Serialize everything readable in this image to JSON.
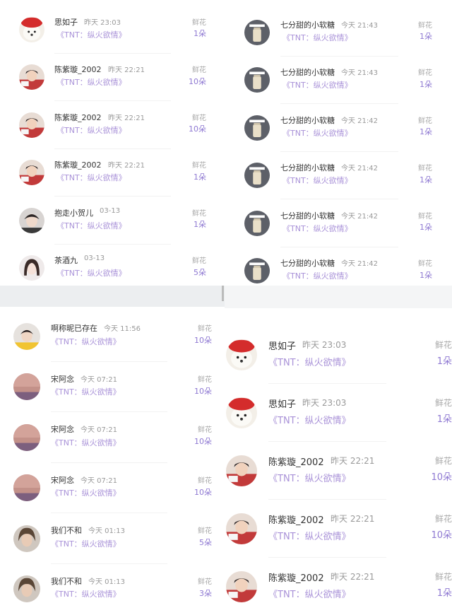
{
  "panels": [
    {
      "id": "top-left",
      "rows": [
        {
          "name": "思如子",
          "time": "昨天 23:03",
          "title": "《TNT：纵火欲情》",
          "gift": "鲜花",
          "count": "1朵",
          "avatar": "dog"
        },
        {
          "name": "陈紫璇_2002",
          "time": "昨天 22:21",
          "title": "《TNT：纵火欲情》",
          "gift": "鲜花",
          "count": "10朵",
          "avatar": "boy-red"
        },
        {
          "name": "陈紫璇_2002",
          "time": "昨天 22:21",
          "title": "《TNT：纵火欲情》",
          "gift": "鲜花",
          "count": "10朵",
          "avatar": "boy-red"
        },
        {
          "name": "陈紫璇_2002",
          "time": "昨天 22:21",
          "title": "《TNT：纵火欲情》",
          "gift": "鲜花",
          "count": "1朵",
          "avatar": "boy-red"
        },
        {
          "name": "抱走小贺儿",
          "time": "03-13",
          "title": "《TNT：纵火欲情》",
          "gift": "鲜花",
          "count": "1朵",
          "avatar": "boy-dark"
        },
        {
          "name": "茶酒九",
          "time": "03-13",
          "title": "《TNT：纵火欲情》",
          "gift": "鲜花",
          "count": "5朵",
          "avatar": "girl"
        }
      ]
    },
    {
      "id": "top-right",
      "rows": [
        {
          "name": "七分甜的小软糖",
          "time": "今天 21:43",
          "title": "《TNT：纵火欲情》",
          "gift": "鲜花",
          "count": "1朵",
          "avatar": "jar"
        },
        {
          "name": "七分甜的小软糖",
          "time": "今天 21:43",
          "title": "《TNT：纵火欲情》",
          "gift": "鲜花",
          "count": "1朵",
          "avatar": "jar"
        },
        {
          "name": "七分甜的小软糖",
          "time": "今天 21:42",
          "title": "《TNT：纵火欲情》",
          "gift": "鲜花",
          "count": "1朵",
          "avatar": "jar"
        },
        {
          "name": "七分甜的小软糖",
          "time": "今天 21:42",
          "title": "《TNT：纵火欲情》",
          "gift": "鲜花",
          "count": "1朵",
          "avatar": "jar"
        },
        {
          "name": "七分甜的小软糖",
          "time": "今天 21:42",
          "title": "《TNT：纵火欲情》",
          "gift": "鲜花",
          "count": "1朵",
          "avatar": "jar"
        },
        {
          "name": "七分甜的小软糖",
          "time": "今天 21:42",
          "title": "《TNT：纵火欲情》",
          "gift": "鲜花",
          "count": "1朵",
          "avatar": "jar"
        }
      ]
    },
    {
      "id": "bottom-left",
      "rows": [
        {
          "name": "啊称昵已存在",
          "time": "今天 11:56",
          "title": "《TNT：纵火欲情》",
          "gift": "鲜花",
          "count": "10朵",
          "avatar": "boy-yellow"
        },
        {
          "name": "宋阿念",
          "time": "今天 07:21",
          "title": "《TNT：纵火欲情》",
          "gift": "鲜花",
          "count": "10朵",
          "avatar": "sunset"
        },
        {
          "name": "宋阿念",
          "time": "今天 07:21",
          "title": "《TNT：纵火欲情》",
          "gift": "鲜花",
          "count": "10朵",
          "avatar": "sunset"
        },
        {
          "name": "宋阿念",
          "time": "今天 07:21",
          "title": "《TNT：纵火欲情》",
          "gift": "鲜花",
          "count": "10朵",
          "avatar": "sunset"
        },
        {
          "name": "我们不和",
          "time": "今天 01:13",
          "title": "《TNT：纵火欲情》",
          "gift": "鲜花",
          "count": "5朵",
          "avatar": "boy-hair"
        },
        {
          "name": "我们不和",
          "time": "今天 01:13",
          "title": "《TNT：纵火欲情》",
          "gift": "鲜花",
          "count": "3朵",
          "avatar": "boy-hair"
        }
      ]
    },
    {
      "id": "bottom-right",
      "rows": [
        {
          "name": "思如子",
          "time": "昨天 23:03",
          "title": "《TNT：纵火欲情》",
          "gift": "鲜花",
          "count": "1朵",
          "avatar": "dog"
        },
        {
          "name": "思如子",
          "time": "昨天 23:03",
          "title": "《TNT：纵火欲情》",
          "gift": "鲜花",
          "count": "1朵",
          "avatar": "dog"
        },
        {
          "name": "陈紫璇_2002",
          "time": "昨天 22:21",
          "title": "《TNT：纵火欲情》",
          "gift": "鲜花",
          "count": "10朵",
          "avatar": "boy-red"
        },
        {
          "name": "陈紫璇_2002",
          "time": "昨天 22:21",
          "title": "《TNT：纵火欲情》",
          "gift": "鲜花",
          "count": "10朵",
          "avatar": "boy-red"
        },
        {
          "name": "陈紫璇_2002",
          "time": "昨天 22:21",
          "title": "《TNT：纵火欲情》",
          "gift": "鲜花",
          "count": "1朵",
          "avatar": "boy-red"
        }
      ]
    }
  ],
  "colors": {
    "title": "#a992d8",
    "count": "#8e78d2",
    "name": "#333333",
    "time": "#999999",
    "gift": "#aaaaaa"
  }
}
